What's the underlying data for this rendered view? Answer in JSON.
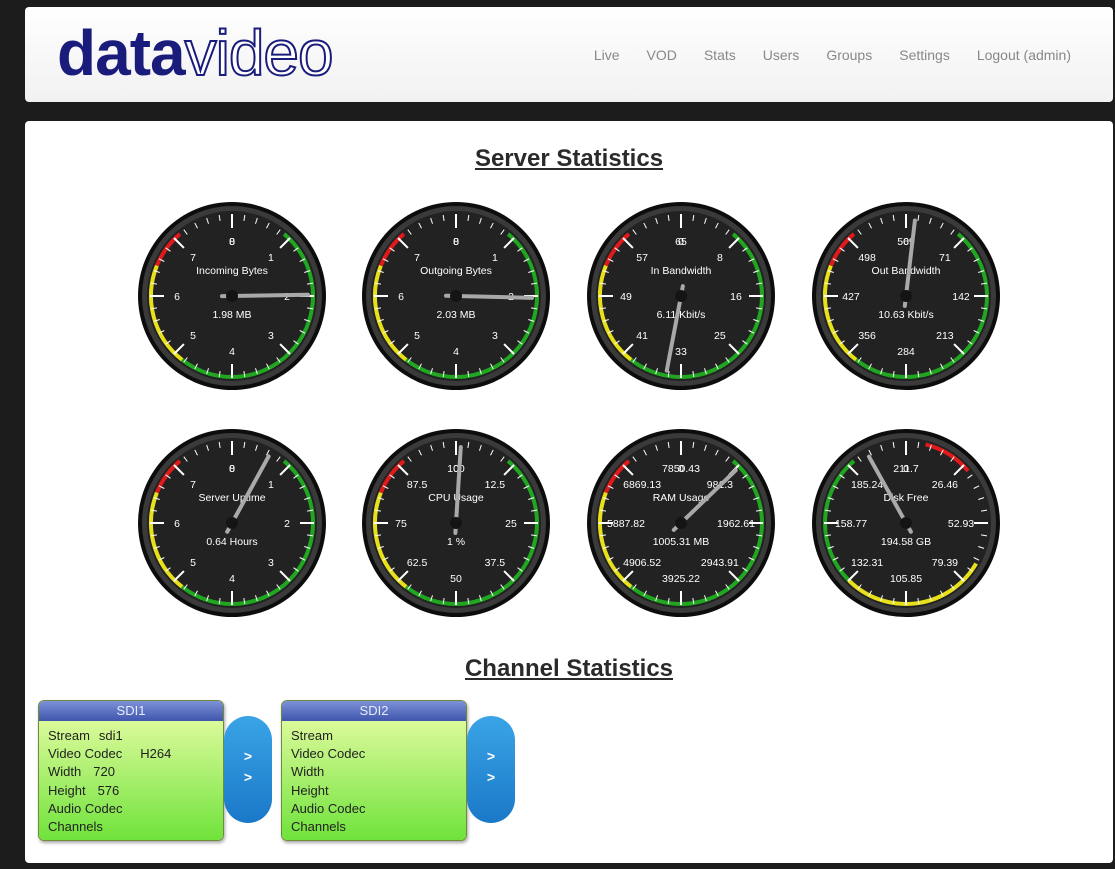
{
  "nav": {
    "logo_bold": "data",
    "logo_light": "video",
    "links": [
      "Live",
      "VOD",
      "Stats",
      "Users",
      "Groups",
      "Settings",
      "Logout (admin)"
    ]
  },
  "server_title": "Server Statistics",
  "channel_title": "Channel Statistics",
  "gauges": [
    {
      "label": "Incoming Bytes",
      "value": "1.98 MB",
      "ticks": [
        "0",
        "1",
        "2",
        "3",
        "4",
        "5",
        "6",
        "7",
        "8"
      ],
      "needle_fraction": 0.2475,
      "zones": [
        "red",
        "yellow",
        "green"
      ]
    },
    {
      "label": "Outgoing Bytes",
      "value": "2.03 MB",
      "ticks": [
        "0",
        "1",
        "2",
        "3",
        "4",
        "5",
        "6",
        "7",
        "8"
      ],
      "needle_fraction": 0.2538,
      "zones": [
        "red",
        "yellow",
        "green"
      ]
    },
    {
      "label": "In Bandwidth",
      "value": "6.11 Kbit/s",
      "ticks": [
        "0",
        "8",
        "16",
        "25",
        "33",
        "41",
        "49",
        "57",
        "65"
      ],
      "needle_fraction": 0.53,
      "zones": [
        "red",
        "yellow",
        "green"
      ]
    },
    {
      "label": "Out Bandwidth",
      "value": "10.63 Kbit/s",
      "ticks": [
        "0",
        "71",
        "142",
        "213",
        "284",
        "356",
        "427",
        "498",
        "569"
      ],
      "needle_fraction": 0.0187,
      "zones": [
        "red",
        "yellow",
        "green"
      ]
    },
    {
      "label": "Server Uptime",
      "value": "0.64 Hours",
      "ticks": [
        "0",
        "1",
        "2",
        "3",
        "4",
        "5",
        "6",
        "7",
        "8"
      ],
      "needle_fraction": 0.08,
      "zones": [
        "red",
        "yellow",
        "green"
      ]
    },
    {
      "label": "CPU Usage",
      "value": "1 %",
      "ticks": [
        "0",
        "12.5",
        "25",
        "37.5",
        "50",
        "62.5",
        "75",
        "87.5",
        "100"
      ],
      "needle_fraction": 0.01,
      "zones": [
        "red",
        "yellow",
        "green"
      ]
    },
    {
      "label": "RAM Usage",
      "value": "1005.31 MB",
      "ticks": [
        "0",
        "981.3",
        "1962.61",
        "2943.91",
        "3925.22",
        "4906.52",
        "5887.82",
        "6869.13",
        "7850.43"
      ],
      "needle_fraction": 0.128,
      "zones": [
        "red",
        "yellow",
        "green"
      ]
    },
    {
      "label": "Disk Free",
      "value": "194.58 GB",
      "ticks": [
        "0",
        "26.46",
        "52.93",
        "79.39",
        "105.85",
        "132.31",
        "158.77",
        "185.24",
        "211.7"
      ],
      "needle_fraction": 0.919,
      "zones": [
        "green",
        "yellow",
        "red"
      ]
    }
  ],
  "channels": [
    {
      "name": "SDI1",
      "rows": [
        {
          "label": "Stream",
          "value": "sdi1"
        },
        {
          "label": "Video Codec",
          "value": "H264"
        },
        {
          "label": "Width",
          "value": "720"
        },
        {
          "label": "Height",
          "value": "576"
        },
        {
          "label": "Audio Codec",
          "value": ""
        },
        {
          "label": "Channels",
          "value": ""
        }
      ],
      "button_line1": ">",
      "button_line2": ">"
    },
    {
      "name": "SDI2",
      "rows": [
        {
          "label": "Stream",
          "value": ""
        },
        {
          "label": "Video Codec",
          "value": ""
        },
        {
          "label": "Width",
          "value": ""
        },
        {
          "label": "Height",
          "value": ""
        },
        {
          "label": "Audio Codec",
          "value": ""
        },
        {
          "label": "Channels",
          "value": ""
        }
      ],
      "button_line1": ">",
      "button_line2": ">"
    }
  ],
  "colors": {
    "red": "#e01a1a",
    "yellow": "#e8e01a",
    "green": "#21a621",
    "dial": "#222222",
    "needle": "#a9a9a9"
  }
}
